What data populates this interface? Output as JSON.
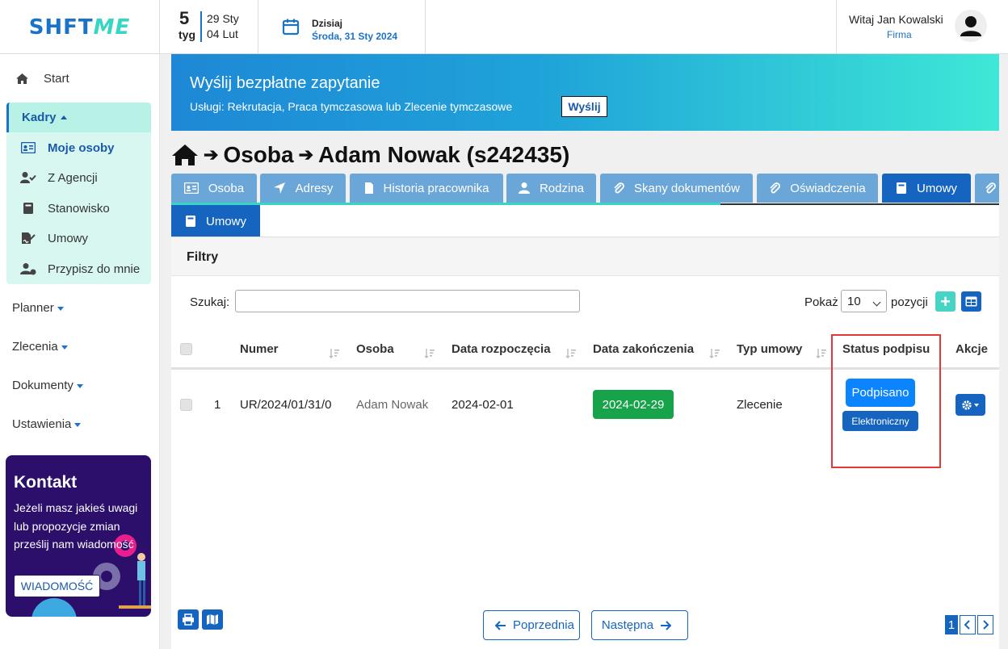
{
  "header": {
    "logo_part1": "SHFT",
    "logo_part2": "ME",
    "week_number": "5",
    "week_label": "tyg",
    "week_start": "29 Sty",
    "week_end": "04 Lut",
    "today_label": "Dzisiaj",
    "today_date": "Środa, 31 Sty 2024",
    "greeting": "Witaj Jan Kowalski",
    "company": "Firma"
  },
  "sidebar": {
    "start": "Start",
    "kadry": "Kadry",
    "kadry_items": [
      {
        "label": "Moje osoby",
        "icon": "id-card-icon"
      },
      {
        "label": "Z Agencji",
        "icon": "user-check-icon"
      },
      {
        "label": "Stanowisko",
        "icon": "book-icon"
      },
      {
        "label": "Umowy",
        "icon": "file-signature-icon"
      },
      {
        "label": "Przypisz do mnie",
        "icon": "user-plus-icon"
      }
    ],
    "menus": [
      "Planner",
      "Zlecenia",
      "Dokumenty",
      "Ustawienia"
    ],
    "contact": {
      "title": "Kontakt",
      "text": "Jeżeli masz jakieś uwagi lub propozycje zmian prześlij nam wiadomość",
      "button": "WIADOMOŚĆ"
    }
  },
  "banner": {
    "title": "Wyślij bezpłatne zapytanie",
    "subtitle": "Usługi: Rekrutacja, Praca tymczasowa lub Zlecenie tymczasowe",
    "button": "Wyślij"
  },
  "page": {
    "crumb1": "Osoba",
    "crumb2": "Adam Nowak (s242435)"
  },
  "tabs": [
    {
      "label": "Osoba",
      "icon": "id-card-icon"
    },
    {
      "label": "Adresy",
      "icon": "location-arrow-icon"
    },
    {
      "label": "Historia pracownika",
      "icon": "file-icon"
    },
    {
      "label": "Rodzina",
      "icon": "user-icon"
    },
    {
      "label": "Skany dokumentów",
      "icon": "paperclip-icon"
    },
    {
      "label": "Oświadczenia",
      "icon": "paperclip-icon"
    },
    {
      "label": "Umowy",
      "icon": "book-icon",
      "active": true
    }
  ],
  "subtab": "Umowy",
  "filters": {
    "title": "Filtry",
    "search_label": "Szukaj:",
    "search_value": "",
    "show_label": "Pokaż",
    "page_size": "10",
    "positions_label": "pozycji"
  },
  "table": {
    "columns": [
      "Numer",
      "Osoba",
      "Data rozpoczęcia",
      "Data zakończenia",
      "Typ umowy",
      "Status podpisu",
      "Akcje"
    ],
    "rows": [
      {
        "index": "1",
        "numer": "UR/2024/01/31/0",
        "osoba": "Adam Nowak",
        "start": "2024-02-01",
        "end": "2024-02-29",
        "typ": "Zlecenie",
        "status": "Podpisano",
        "status_type": "Elektroniczny"
      }
    ]
  },
  "pagination": {
    "prev": "Poprzednia",
    "next": "Następna",
    "current": "1"
  },
  "colors": {
    "primary": "#1565c0",
    "accent": "#37d6c4",
    "success": "#16a34a",
    "highlight": "#e53935"
  }
}
